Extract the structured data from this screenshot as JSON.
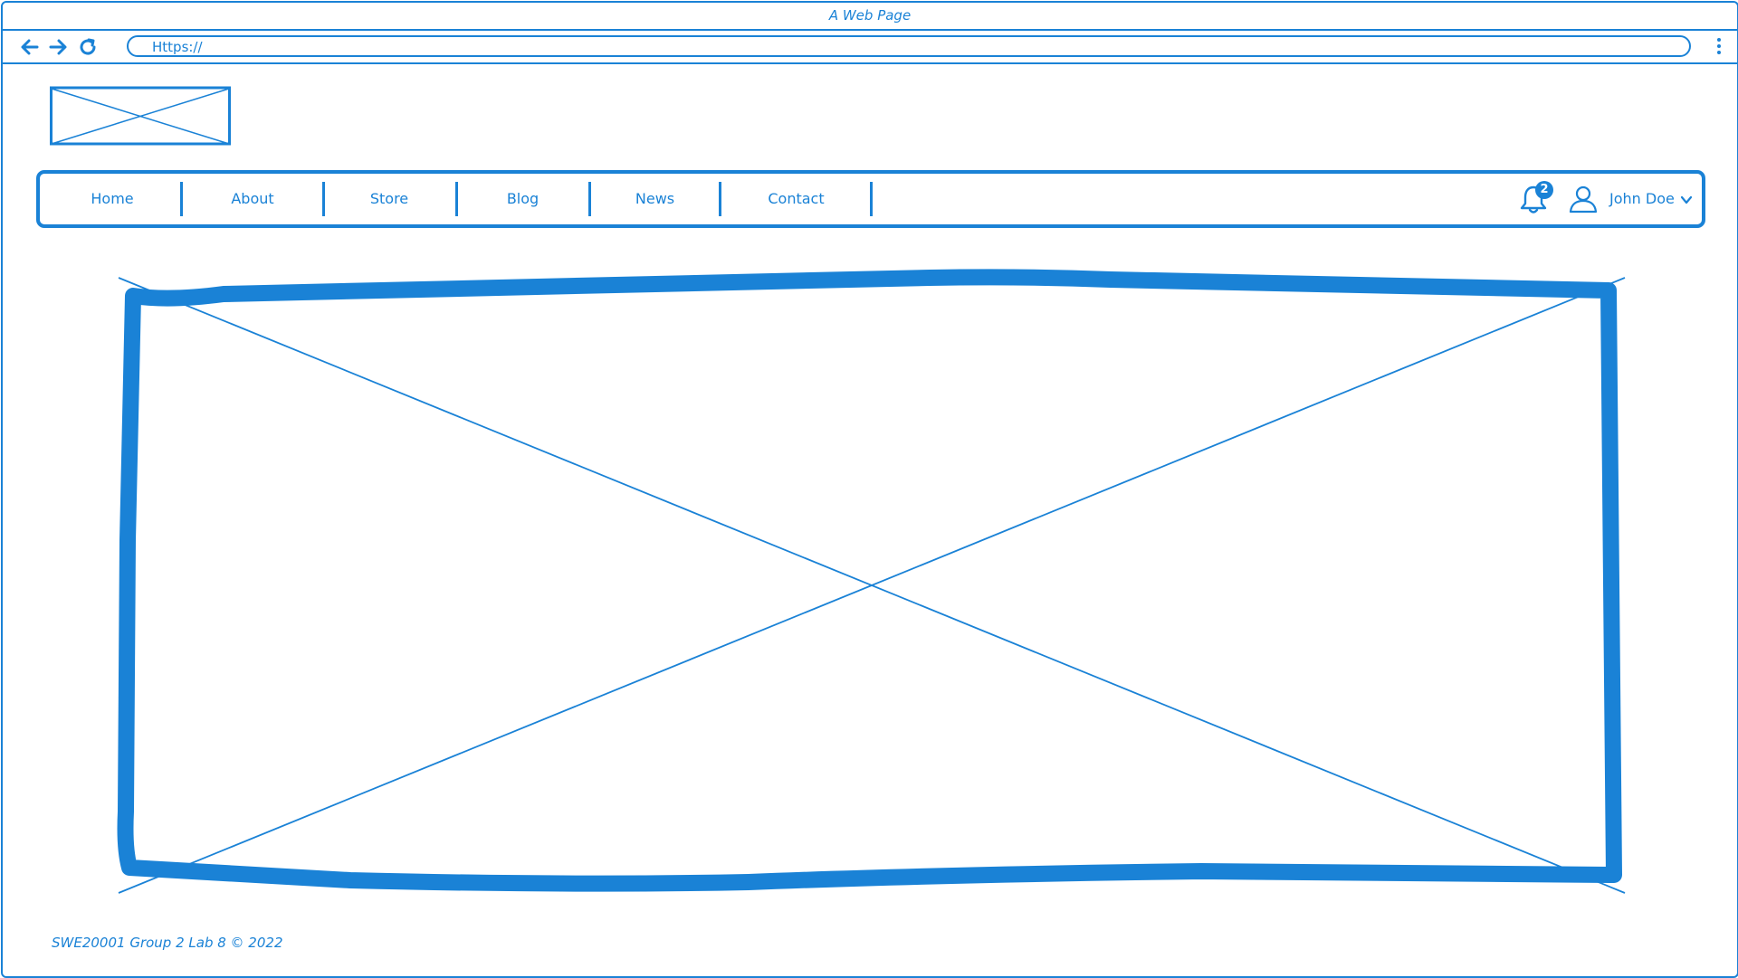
{
  "window": {
    "title": "A Web Page"
  },
  "browser": {
    "url": "Https://"
  },
  "nav": {
    "items": [
      "Home",
      "About",
      "Store",
      "Blog",
      "News",
      "Contact"
    ]
  },
  "user": {
    "notification_count": "2",
    "name": "John Doe"
  },
  "footer": {
    "text": "SWE20001 Group 2 Lab 8 © 2022"
  },
  "icons": {
    "back": "arrow-left-icon",
    "forward": "arrow-right-icon",
    "reload": "reload-icon",
    "menu": "kebab-menu-icon",
    "notifications": "bell-icon",
    "user": "user-icon",
    "dropdown": "chevron-down-icon"
  },
  "colors": {
    "accent": "#1a82d6",
    "background": "#ffffff"
  }
}
